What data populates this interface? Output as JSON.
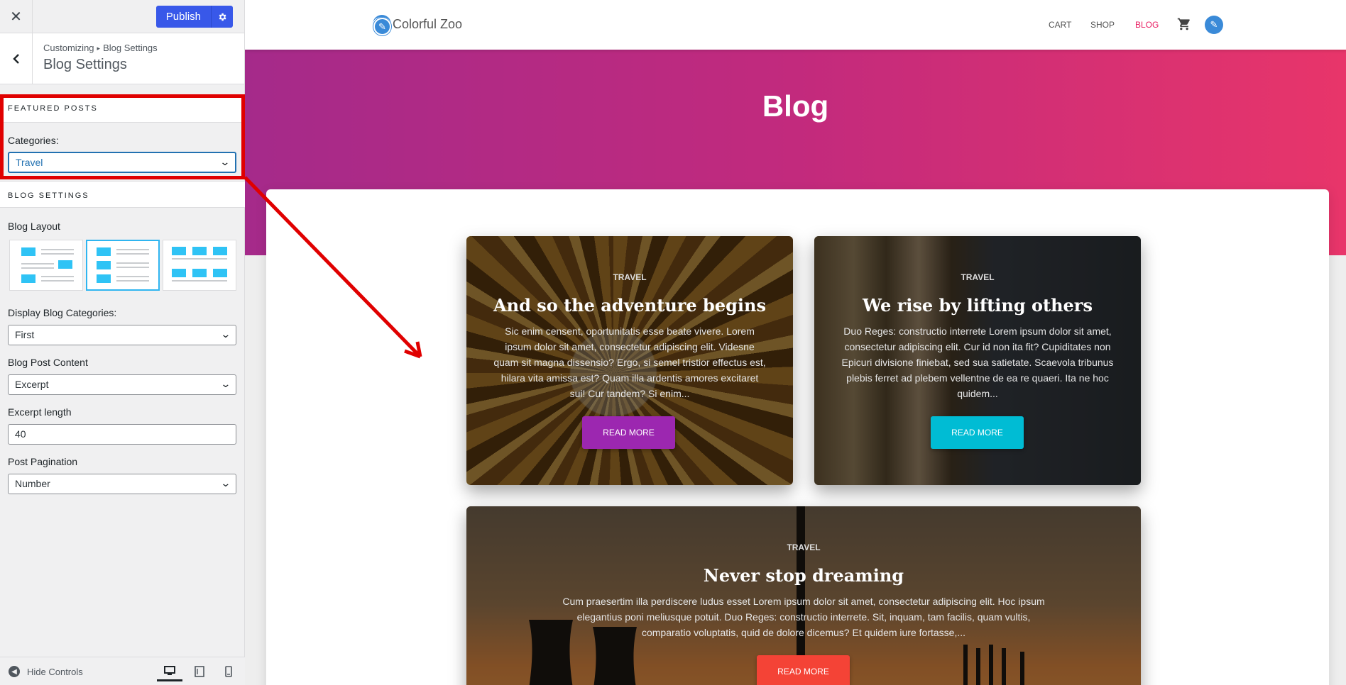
{
  "customizer": {
    "close_icon": "close-icon",
    "publish_label": "Publish",
    "gear_icon": "gear-icon",
    "back_icon": "chevron-left-icon",
    "breadcrumb_root": "Customizing",
    "breadcrumb_current": "Blog Settings",
    "section_title": "Blog Settings",
    "featured_posts": {
      "heading": "Featured Posts",
      "categories_label": "Categories:",
      "categories_value": "Travel"
    },
    "blog_settings": {
      "heading": "Blog Settings",
      "layout_label": "Blog Layout",
      "layout_selected": "2",
      "display_categories_label": "Display Blog Categories:",
      "display_categories_value": "First",
      "post_content_label": "Blog Post Content",
      "post_content_value": "Excerpt",
      "excerpt_length_label": "Excerpt length",
      "excerpt_length_value": "40",
      "pagination_label": "Post Pagination",
      "pagination_value": "Number"
    },
    "hide_controls_label": "Hide Controls",
    "devices": [
      "desktop",
      "tablet",
      "mobile"
    ],
    "active_device": "desktop"
  },
  "site": {
    "title": "Colorful Zoo",
    "nav": [
      "CART",
      "SHOP",
      "BLOG"
    ],
    "active_nav": "BLOG",
    "hero_title": "Blog",
    "posts": [
      {
        "category": "TRAVEL",
        "title": "And so the adventure begins",
        "excerpt": "Sic enim censent, oportunitatis esse beate vivere. Lorem ipsum dolor sit amet, consectetur adipiscing elit. Videsne quam sit magna dissensio? Ergo, si semel tristior effectus est, hilara vita amissa est? Quam illa ardentis amores excitaret sui! Cur tandem? Si enim...",
        "button": "READ MORE",
        "button_color": "#9c27b0"
      },
      {
        "category": "TRAVEL",
        "title": "We rise by lifting others",
        "excerpt": "Duo Reges: constructio interrete Lorem ipsum dolor sit amet, consectetur adipiscing elit. Cur id non ita fit? Cupiditates non Epicuri divisione finiebat, sed sua satietate. Scaevola tribunus plebis ferret ad plebem vellentne de ea re quaeri. Ita ne hoc quidem...",
        "button": "READ MORE",
        "button_color": "#00bcd4"
      },
      {
        "category": "TRAVEL",
        "title": "Never stop dreaming",
        "excerpt": "Cum praesertim illa perdiscere ludus esset Lorem ipsum dolor sit amet, consectetur adipiscing elit. Hoc ipsum elegantius poni meliusque potuit. Duo Reges: constructio interrete. Sit, inquam, tam facilis, quam vultis, comparatio voluptatis, quid de dolore dicemus? Et quidem iure fortasse,...",
        "button": "READ MORE",
        "button_color": "#f44336"
      }
    ]
  },
  "colors": {
    "annotation_red": "#e00000",
    "publish_blue": "#3858e9",
    "hero_start": "#a52a8a",
    "hero_end": "#e8356a",
    "accent_pink": "#e91e63"
  }
}
